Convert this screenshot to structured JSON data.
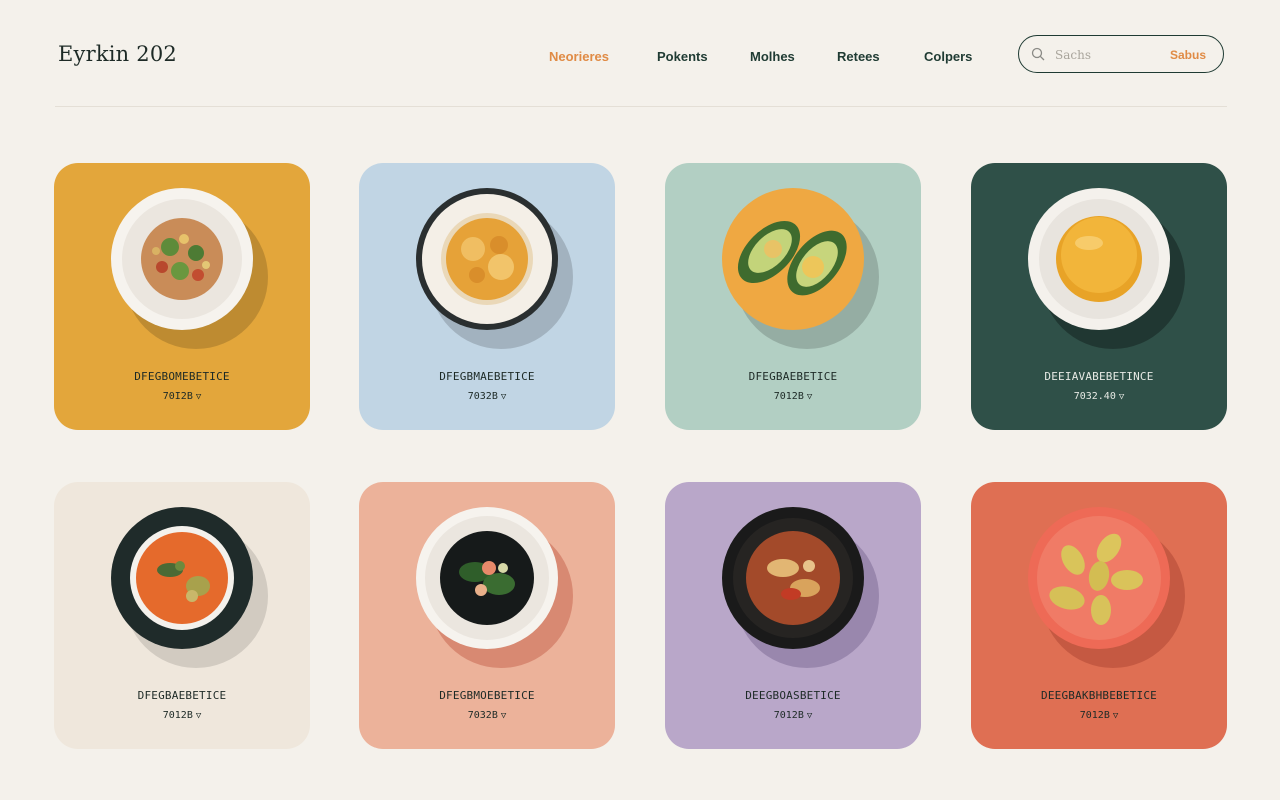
{
  "brand": {
    "logo": "Eyrkin 202"
  },
  "nav": {
    "items": [
      {
        "label": "Neorieres",
        "active": true
      },
      {
        "label": "Pokents",
        "active": false
      },
      {
        "label": "Molhes",
        "active": false
      },
      {
        "label": "Retees",
        "active": false
      },
      {
        "label": "Colpers",
        "active": false
      }
    ]
  },
  "search": {
    "placeholder": "Sachs",
    "button_label": "Sabus",
    "icon": "search-icon"
  },
  "colors": {
    "accent": "#e08b45",
    "text": "#1f3b33",
    "background": "#f4f1eb"
  },
  "cards": [
    {
      "title": "DFEGBOMEBETICE",
      "price": "70I2B",
      "bg": "#e3a63b",
      "dish": "grain-salad"
    },
    {
      "title": "DFEGBMAEBETICE",
      "price": "7032B",
      "bg": "#c1d5e4",
      "dish": "gratin-bowl"
    },
    {
      "title": "DFEGBAEBETICE",
      "price": "7012B",
      "bg": "#b2cfc3",
      "dish": "avocado-halves"
    },
    {
      "title": "DEEIAVABEBETINCE",
      "price": "7032.40",
      "bg": "#2f5048",
      "dish": "custard-plate"
    },
    {
      "title": "DFEGBAEBETICE",
      "price": "7012B",
      "bg": "#efe7dc",
      "dish": "tomato-curry"
    },
    {
      "title": "DFEGBMOEBETICE",
      "price": "7032B",
      "bg": "#ecb29a",
      "dish": "greens-bowl"
    },
    {
      "title": "DEEGBOASBETICE",
      "price": "7012B",
      "bg": "#b9a7c9",
      "dish": "roasted-stew"
    },
    {
      "title": "DEEGBAKBHBEBETICE",
      "price": "7012B",
      "bg": "#df6f53",
      "dish": "baby-potatoes"
    }
  ]
}
